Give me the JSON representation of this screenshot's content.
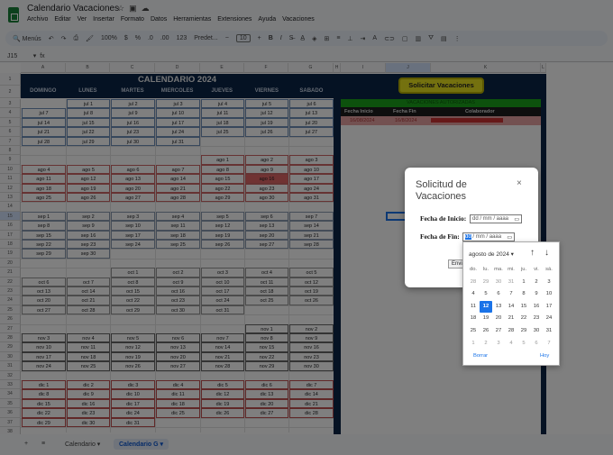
{
  "app": {
    "title": "Calendario Vacaciones",
    "menu": [
      "Archivo",
      "Editar",
      "Ver",
      "Insertar",
      "Formato",
      "Datos",
      "Herramientas",
      "Extensiones",
      "Ayuda",
      "Vacaciones"
    ]
  },
  "toolbar": {
    "search": "Menús",
    "zoom": "100%",
    "currency": "$",
    "percent": "%",
    "dec_less": ".0",
    "dec_more": ".00",
    "format_123": "123",
    "font": "Predet...",
    "font_size": "10",
    "bold": "B",
    "italic": "I"
  },
  "formula_bar": {
    "cell_ref": "J15",
    "fx": "fx"
  },
  "columns": [
    "A",
    "B",
    "C",
    "D",
    "E",
    "F",
    "G",
    "H",
    "I",
    "J",
    "K",
    "L"
  ],
  "calendar": {
    "title": "CALENDARIO 2024",
    "days": [
      "DOMINGO",
      "LUNES",
      "MARTES",
      "MIERCOLES",
      "JUEVES",
      "VIERNES",
      "SABADO"
    ],
    "rows": [
      [
        "",
        "jul 1",
        "jul 2",
        "jul 3",
        "jul 4",
        "jul 5",
        "jul 6"
      ],
      [
        "jul 7",
        "jul 8",
        "jul 9",
        "jul 10",
        "jul 11",
        "jul 12",
        "jul 13"
      ],
      [
        "jul 14",
        "jul 15",
        "jul 16",
        "jul 17",
        "jul 18",
        "jul 19",
        "jul 20"
      ],
      [
        "jul 21",
        "jul 22",
        "jul 23",
        "jul 24",
        "jul 25",
        "jul 26",
        "jul 27"
      ],
      [
        "jul 28",
        "jul 29",
        "jul 30",
        "jul 31",
        "",
        "",
        ""
      ],
      [
        "",
        "",
        "",
        "",
        "",
        "",
        ""
      ],
      [
        "",
        "",
        "",
        "",
        "ago 1",
        "ago 2",
        "ago 3"
      ],
      [
        "ago 4",
        "ago 5",
        "ago 6",
        "ago 7",
        "ago 8",
        "ago 9",
        "ago 10"
      ],
      [
        "ago 11",
        "ago 12",
        "ago 13",
        "ago 14",
        "ago 15",
        "ago 16",
        "ago 17"
      ],
      [
        "ago 18",
        "ago 19",
        "ago 20",
        "ago 21",
        "ago 22",
        "ago 23",
        "ago 24"
      ],
      [
        "ago 25",
        "ago 26",
        "ago 27",
        "ago 28",
        "ago 29",
        "ago 30",
        "ago 31"
      ],
      [
        "",
        "",
        "",
        "",
        "",
        "",
        ""
      ],
      [
        "sep 1",
        "sep 2",
        "sep 3",
        "sep 4",
        "sep 5",
        "sep 6",
        "sep 7"
      ],
      [
        "sep 8",
        "sep 9",
        "sep 10",
        "sep 11",
        "sep 12",
        "sep 13",
        "sep 14"
      ],
      [
        "sep 15",
        "sep 16",
        "sep 17",
        "sep 18",
        "sep 19",
        "sep 20",
        "sep 21"
      ],
      [
        "sep 22",
        "sep 23",
        "sep 24",
        "sep 25",
        "sep 26",
        "sep 27",
        "sep 28"
      ],
      [
        "sep 29",
        "sep 30",
        "",
        "",
        "",
        "",
        ""
      ],
      [
        "",
        "",
        "",
        "",
        "",
        "",
        ""
      ],
      [
        "",
        "",
        "oct 1",
        "oct 2",
        "oct 3",
        "oct 4",
        "oct 5"
      ],
      [
        "oct 6",
        "oct 7",
        "oct 8",
        "oct 9",
        "oct 10",
        "oct 11",
        "oct 12"
      ],
      [
        "oct 13",
        "oct 14",
        "oct 15",
        "oct 16",
        "oct 17",
        "oct 18",
        "oct 19"
      ],
      [
        "oct 20",
        "oct 21",
        "oct 22",
        "oct 23",
        "oct 24",
        "oct 25",
        "oct 26"
      ],
      [
        "oct 27",
        "oct 28",
        "oct 29",
        "oct 30",
        "oct 31",
        "",
        ""
      ],
      [
        "",
        "",
        "",
        "",
        "",
        "",
        ""
      ],
      [
        "",
        "",
        "",
        "",
        "",
        "nov 1",
        "nov 2"
      ],
      [
        "nov 3",
        "nov 4",
        "nov 5",
        "nov 6",
        "nov 7",
        "nov 8",
        "nov 9"
      ],
      [
        "nov 10",
        "nov 11",
        "nov 12",
        "nov 13",
        "nov 14",
        "nov 15",
        "nov 16"
      ],
      [
        "nov 17",
        "nov 18",
        "nov 19",
        "nov 20",
        "nov 21",
        "nov 22",
        "nov 23"
      ],
      [
        "nov 24",
        "nov 25",
        "nov 26",
        "nov 27",
        "nov 28",
        "nov 29",
        "nov 30"
      ],
      [
        "",
        "",
        "",
        "",
        "",
        "",
        ""
      ],
      [
        "dic 1",
        "dic 2",
        "dic 3",
        "dic 4",
        "dic 5",
        "dic 6",
        "dic 7"
      ],
      [
        "dic 8",
        "dic 9",
        "dic 10",
        "dic 11",
        "dic 12",
        "dic 13",
        "dic 14"
      ],
      [
        "dic 15",
        "dic 16",
        "dic 17",
        "dic 18",
        "dic 19",
        "dic 20",
        "dic 21"
      ],
      [
        "dic 22",
        "dic 23",
        "dic 24",
        "dic 25",
        "dic 26",
        "dic 27",
        "dic 28"
      ],
      [
        "dic 29",
        "dic 30",
        "dic 31",
        "",
        "",
        "",
        ""
      ]
    ],
    "highlighted": "ago 16",
    "highlight_color": "#e06666"
  },
  "panel": {
    "button": "Solicitar Vacaciones",
    "header": "VACACIONES AUTORIZADAS",
    "col_start": "Fecha Inicio",
    "col_end": "Fecha Fin",
    "col_person": "Colaborador",
    "row_start": "16/08/2024",
    "row_end": "16/8/2024",
    "navy": "#0b2447"
  },
  "tabs": {
    "add": "+",
    "all": "≡",
    "sheets": [
      "Calendario",
      "Calendario G"
    ],
    "active": "Calendario G"
  },
  "dialog": {
    "title": "Solicitud de Vacaciones",
    "close": "×",
    "start_label": "Fecha de Inicio:",
    "end_label": "Fecha de Fin:",
    "placeholder": "dd / mm / aaaa",
    "end_day_part": "dd",
    "end_rest": "/ mm / aaaa",
    "send": "Enviar"
  },
  "picker": {
    "month": "agosto de 2024 ▾",
    "weekdays": [
      "do.",
      "lu.",
      "ma.",
      "mi.",
      "ju.",
      "vi.",
      "sá."
    ],
    "days": [
      "28",
      "29",
      "30",
      "31",
      "1",
      "2",
      "3",
      "4",
      "5",
      "6",
      "7",
      "8",
      "9",
      "10",
      "11",
      "12",
      "13",
      "14",
      "15",
      "16",
      "17",
      "18",
      "19",
      "20",
      "21",
      "22",
      "23",
      "24",
      "25",
      "26",
      "27",
      "28",
      "29",
      "30",
      "31",
      "1",
      "2",
      "3",
      "4",
      "5",
      "6",
      "7"
    ],
    "selected": "12",
    "clear": "Borrar",
    "today": "Hoy"
  }
}
